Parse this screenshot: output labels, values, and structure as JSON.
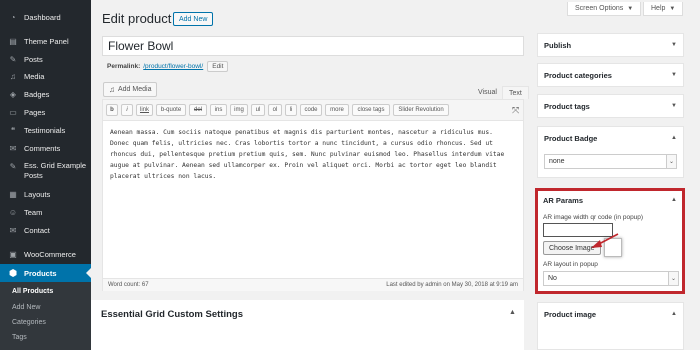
{
  "sidebar": {
    "items": [
      {
        "label": "Dashboard",
        "icon": "dashboard-icon",
        "glyph": "◔"
      },
      {
        "label": "Theme Panel",
        "icon": "theme-panel-icon",
        "glyph": "▤"
      },
      {
        "label": "Posts",
        "icon": "pin-icon",
        "glyph": "✎"
      },
      {
        "label": "Media",
        "icon": "media-icon",
        "glyph": "♫"
      },
      {
        "label": "Badges",
        "icon": "badge-icon",
        "glyph": "◈"
      },
      {
        "label": "Pages",
        "icon": "pages-icon",
        "glyph": "▭"
      },
      {
        "label": "Testimonials",
        "icon": "testimonial-icon",
        "glyph": "❝"
      },
      {
        "label": "Comments",
        "icon": "comment-icon",
        "glyph": "✉"
      },
      {
        "label": "Ess. Grid Example Posts",
        "icon": "pin-icon",
        "glyph": "✎"
      },
      {
        "label": "Layouts",
        "icon": "layouts-icon",
        "glyph": "▦"
      },
      {
        "label": "Team",
        "icon": "team-icon",
        "glyph": "☺"
      },
      {
        "label": "Contact",
        "icon": "contact-icon",
        "glyph": "✉"
      },
      {
        "label": "WooCommerce",
        "icon": "woocommerce-icon",
        "glyph": "▣"
      }
    ],
    "active": {
      "label": "Products",
      "icon": "products-icon",
      "glyph": "⬢"
    },
    "submenu": [
      "All Products",
      "Add New",
      "Categories",
      "Tags"
    ]
  },
  "top": {
    "screen_options": "Screen Options",
    "help": "Help"
  },
  "page": {
    "title": "Edit product",
    "add_new": "Add New"
  },
  "post": {
    "title": "Flower Bowl",
    "permalink_label": "Permalink:",
    "permalink_url": "/product/flower-bowl/",
    "edit_label": "Edit"
  },
  "editor": {
    "add_media": "Add Media",
    "tab_visual": "Visual",
    "tab_text": "Text",
    "quicktags": [
      "b",
      "i",
      "link",
      "b-quote",
      "del",
      "ins",
      "img",
      "ul",
      "ol",
      "li",
      "code",
      "more",
      "close tags",
      "Slider Revolution"
    ],
    "content": "Aenean massa. Cum sociis natoque penatibus et magnis dis parturient montes, nascetur a ridiculus mus. Donec quam felis, ultricies nec. Cras lobortis tortor a nunc tincidunt, a cursus odio rhoncus. Sed ut rhoncus dui, pellentesque pretium pretium quis, sem. Nunc pulvinar euismod leo. Phasellus interdum vitae augue at pulvinar. Aenean sed ullamcorper ex. Proin vel aliquet orci. Morbi ac tortor eget leo blandit placerat ultrices non lacus.",
    "word_count": "Word count: 67",
    "last_edited": "Last edited by admin on May 30, 2018 at 9:19 am"
  },
  "essential_grid": {
    "title": "Essential Grid Custom Settings"
  },
  "right": {
    "publish": "Publish",
    "categories": "Product categories",
    "tags": "Product tags",
    "badge": "Product Badge",
    "badge_value": "none",
    "ar_title": "AR Params",
    "ar_width_label": "AR image width qr code (in popup)",
    "choose_image": "Choose Image",
    "ar_layout_label": "AR layout in popup",
    "ar_layout_value": "No",
    "product_image": "Product image"
  },
  "colors": {
    "accent": "#0073aa",
    "highlight": "#c0272d",
    "sidebar": "#23282d"
  }
}
